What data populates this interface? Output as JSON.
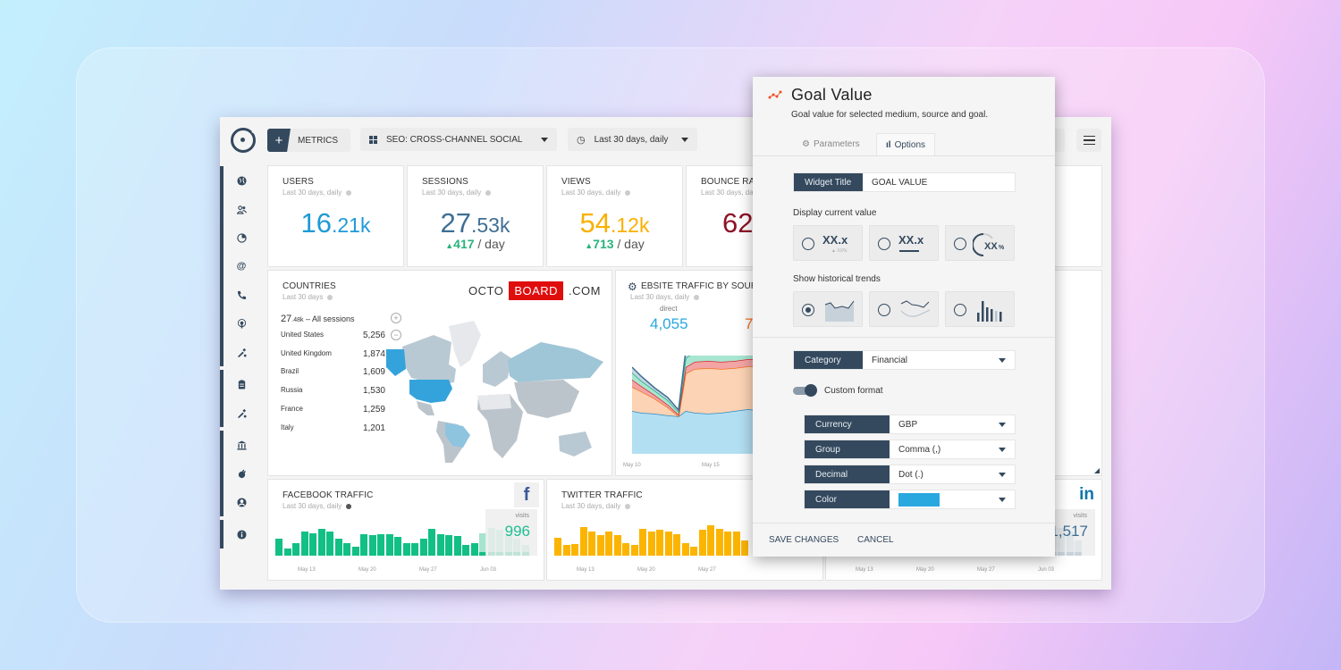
{
  "toolbar": {
    "metrics_label": "METRICS",
    "dashboard_select": "SEO: CROSS-CHANNEL SOCIAL",
    "period_select": "Last 30 days, daily"
  },
  "sidebar": {
    "icons": [
      "globe-icon",
      "users-icon",
      "analytics-icon",
      "at-icon",
      "phone-icon",
      "touch-icon",
      "tools-icon",
      "clipboard-icon",
      "tools-icon",
      "bank-icon",
      "plug-icon",
      "user-circle-icon",
      "info-icon"
    ]
  },
  "kpis": [
    {
      "title": "USERS",
      "sub": "Last 30 days, daily",
      "int": "16",
      "dec": ".21k",
      "color": "#1e9ad6"
    },
    {
      "title": "SESSIONS",
      "sub": "Last 30 days, daily",
      "int": "27",
      "dec": ".53k",
      "color": "#3e6f94",
      "delta": "417",
      "per": " / day"
    },
    {
      "title": "VIEWS",
      "sub": "Last 30 days, daily",
      "int": "54",
      "dec": ".12k",
      "color": "#f9b000",
      "delta": "713",
      "per": " / day"
    },
    {
      "title": "BOUNCE RATE",
      "sub": "Last 30 days, daily",
      "int": "62",
      "color": "#8e1127"
    }
  ],
  "countries": {
    "title": "COUNTRIES",
    "sub": "Last 30 days",
    "total_int": "27",
    "total_dec": ".48k",
    "total_label": " – All sessions",
    "rows": [
      {
        "name": "United States",
        "value": "5,256"
      },
      {
        "name": "United Kingdom",
        "value": "1,874"
      },
      {
        "name": "Brazil",
        "value": "1,609"
      },
      {
        "name": "Russia",
        "value": "1,530"
      },
      {
        "name": "France",
        "value": "1,259"
      },
      {
        "name": "Italy",
        "value": "1,201"
      }
    ],
    "zoom_in": "+",
    "zoom_out": "−"
  },
  "brand": {
    "left": "OCTO",
    "mid": "BOARD",
    "right": ".COM"
  },
  "traffic": {
    "title": "EBSITE TRAFFIC BY SOURCE",
    "sub": "Last 30 days, daily",
    "direct_label": "direct",
    "direct_value": "4,055",
    "second_value": "7",
    "x_ticks": [
      "May 10",
      "May 15"
    ]
  },
  "facebook": {
    "title": "FACEBOOK TRAFFIC",
    "sub": "Last 30 days, daily",
    "visits_label": "visits",
    "visits_value": "996",
    "x_ticks": [
      "May 13",
      "May 20",
      "May 27",
      "Jun 03"
    ],
    "bars": [
      0.55,
      0.25,
      0.4,
      0.8,
      0.75,
      0.88,
      0.78,
      0.55,
      0.4,
      0.3,
      0.72,
      0.68,
      0.7,
      0.72,
      0.62,
      0.4,
      0.42,
      0.55,
      0.88,
      0.72,
      0.68,
      0.65,
      0.35,
      0.42,
      0.75,
      0.9,
      0.85,
      0.72,
      0.55,
      0.35
    ]
  },
  "twitter": {
    "title": "TWITTER TRAFFIC",
    "sub": "Last 30 days, daily",
    "x_ticks": [
      "May 13",
      "May 20",
      "May 27"
    ],
    "bars": [
      0.6,
      0.35,
      0.38,
      0.95,
      0.78,
      0.68,
      0.8,
      0.68,
      0.42,
      0.36,
      0.88,
      0.8,
      0.85,
      0.8,
      0.72,
      0.4,
      0.3,
      0.85,
      1.0,
      0.88,
      0.8,
      0.78,
      0.5
    ]
  },
  "linkedin": {
    "visits_label": "visits",
    "visits_value": "1,517",
    "x_ticks": [
      "May 13",
      "May 20",
      "May 27",
      "Jun 03"
    ]
  },
  "modal": {
    "title": "Goal Value",
    "description": "Goal value for selected medium, source and goal.",
    "tabs": [
      {
        "label": "Parameters"
      },
      {
        "label": "Options",
        "active": true
      }
    ],
    "widget_title_label": "Widget Title",
    "widget_title_value": "GOAL VALUE",
    "display_current_value_label": "Display current value",
    "display_options": [
      {
        "glyph": "XX.x",
        "selected": false
      },
      {
        "glyph": "XX.x",
        "selected": false
      },
      {
        "glyph": "XX%",
        "selected": false
      }
    ],
    "historical_label": "Show historical trends",
    "trend_options": [
      {
        "name": "area",
        "selected": true
      },
      {
        "name": "line",
        "selected": false
      },
      {
        "name": "bar",
        "selected": false
      }
    ],
    "category_label": "Category",
    "category_value": "Financial",
    "custom_format_label": "Custom format",
    "custom_format_on": true,
    "currency_label": "Currency",
    "currency_value": "GBP",
    "group_label": "Group",
    "group_value": "Comma (,)",
    "decimal_label": "Decimal",
    "decimal_value": "Dot (.)",
    "color_label": "Color",
    "color_value": "#29a8e0",
    "save_label": "SAVE CHANGES",
    "cancel_label": "CANCEL"
  }
}
